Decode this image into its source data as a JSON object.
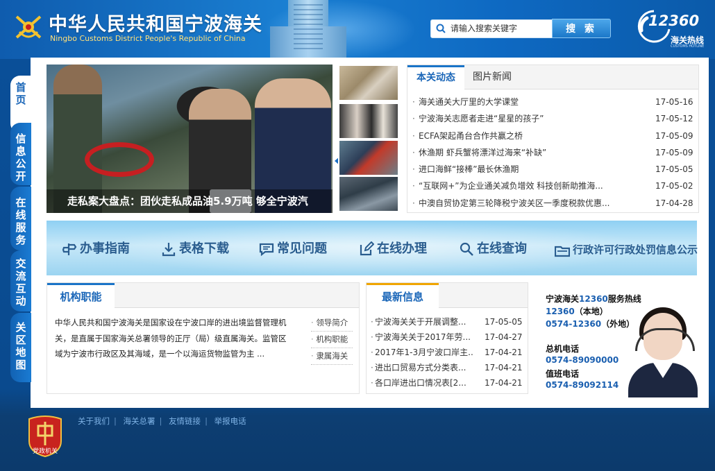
{
  "header": {
    "title_cn": "中华人民共和国宁波海关",
    "title_en": "Ningbo Customs District People's Republic of China",
    "search_placeholder": "请输入搜索关键字",
    "search_button": "搜 索",
    "hotline_number": "12360",
    "hotline_label": "海关热线",
    "hotline_en": "CUSTOMS HOTLINE"
  },
  "sidebar": {
    "items": [
      {
        "label": [
          "首",
          "页"
        ],
        "active": true
      },
      {
        "label": [
          "信",
          "息",
          "公",
          "开"
        ],
        "active": false
      },
      {
        "label": [
          "在",
          "线",
          "服",
          "务"
        ],
        "active": false
      },
      {
        "label": [
          "交",
          "流",
          "互",
          "动"
        ],
        "active": false
      },
      {
        "label": [
          "关",
          "区",
          "地",
          "图"
        ],
        "active": false
      }
    ]
  },
  "slideshow": {
    "caption": "走私案大盘点：团伙走私成品油5.9万吨 够全宁波汽"
  },
  "news": {
    "tabs": [
      "本关动态",
      "图片新闻"
    ],
    "items": [
      {
        "title": "海关通关大厅里的大学课堂",
        "date": "17-05-16"
      },
      {
        "title": "宁波海关志愿者走进“星星的孩子”",
        "date": "17-05-12"
      },
      {
        "title": "ECFA架起甬台合作共赢之桥",
        "date": "17-05-09"
      },
      {
        "title": "休渔期 虾兵蟹将漂洋过海来“补缺”",
        "date": "17-05-09"
      },
      {
        "title": "进口海鲜“接棒”最长休渔期",
        "date": "17-05-05"
      },
      {
        "title": "“互联网+”为企业通关减负增效 科技创新助推海...",
        "date": "17-05-02"
      },
      {
        "title": "中澳自贸协定第三轮降税宁波关区一季度税款优惠...",
        "date": "17-04-28"
      }
    ]
  },
  "services": {
    "items": [
      "办事指南",
      "表格下载",
      "常见问题",
      "在线办理",
      "在线查询",
      "行政许可行政处罚信息公示"
    ]
  },
  "org": {
    "tab": "机构职能",
    "text": "中华人民共和国宁波海关是国家设在宁波口岸的进出境监督管理机关，是直属于国家海关总署领导的正厅（局）级直属海关。监管区域为宁波市行政区及其海域，是一个以海运货物监管为主 ...",
    "links": [
      "领导简介",
      "机构职能",
      "隶属海关"
    ]
  },
  "latest": {
    "tab": "最新信息",
    "items": [
      {
        "title": "宁波海关关于开展调整...",
        "date": "17-05-05"
      },
      {
        "title": "宁波海关关于2017年劳...",
        "date": "17-04-27"
      },
      {
        "title": "2017年1-3月宁波口岸主...",
        "date": "17-04-21"
      },
      {
        "title": "进出口贸易方式分类表...",
        "date": "17-04-21"
      },
      {
        "title": "各口岸进出口情况表[2...",
        "date": "17-04-21"
      }
    ]
  },
  "hotcard": {
    "line1_a": "宁波海关",
    "line1_b": "12360",
    "line1_c": "服务热线",
    "local_num": "12360",
    "local_lbl": "（本地）",
    "remote_num": "0574-12360",
    "remote_lbl": "（外地）",
    "switchboard_lbl": "总机电话",
    "switchboard_num": "0574-89090000",
    "duty_lbl": "值班电话",
    "duty_num": "0574-89092114"
  },
  "footer": {
    "links": [
      "关于我们",
      "海关总署",
      "友情链接",
      "举报电话"
    ],
    "badge_text": "党政机关"
  },
  "colors": {
    "accent": "#1a74c8",
    "latest_accent": "#f0a500"
  }
}
